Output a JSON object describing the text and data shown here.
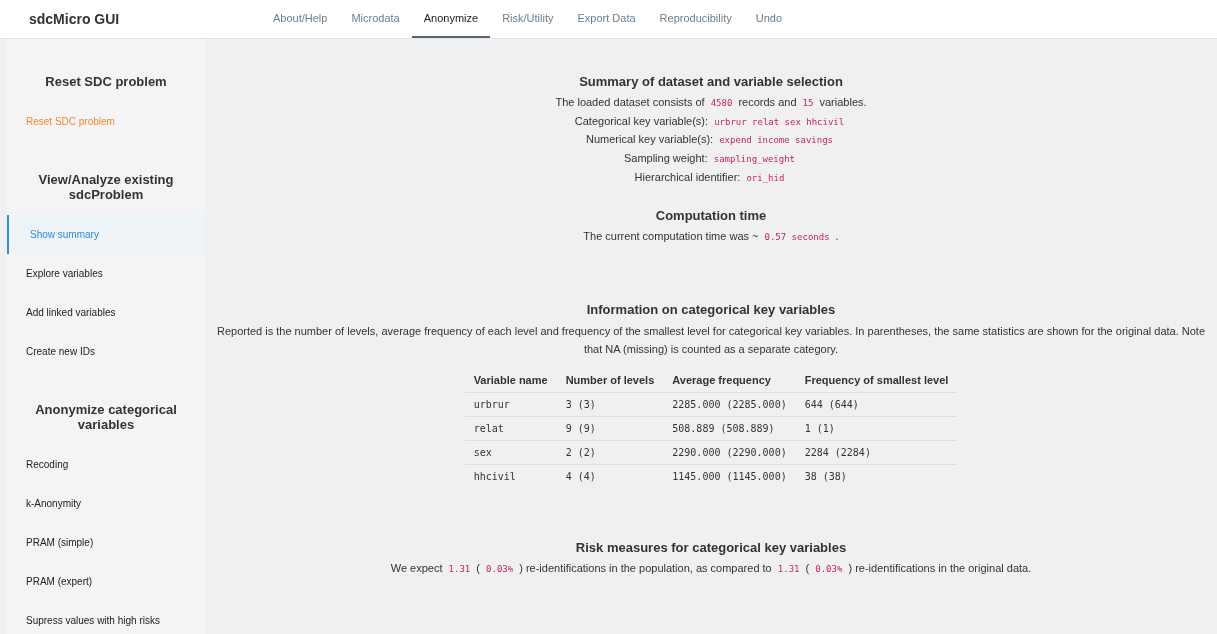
{
  "app_title": "sdcMicro GUI",
  "tabs": [
    {
      "label": "About/Help",
      "selected": false
    },
    {
      "label": "Microdata",
      "selected": false
    },
    {
      "label": "Anonymize",
      "selected": true
    },
    {
      "label": "Risk/Utility",
      "selected": false
    },
    {
      "label": "Export Data",
      "selected": false
    },
    {
      "label": "Reproducibility",
      "selected": false
    },
    {
      "label": "Undo",
      "selected": false
    }
  ],
  "sidebar": {
    "sections": [
      {
        "heading": "Reset SDC problem",
        "items": [
          {
            "label": "Reset SDC problem",
            "kind": "action",
            "selected": false
          }
        ]
      },
      {
        "heading": "View/Analyze existing sdcProblem",
        "items": [
          {
            "label": "Show summary",
            "kind": "nav",
            "selected": true
          },
          {
            "label": "Explore variables",
            "kind": "nav",
            "selected": false
          },
          {
            "label": "Add linked variables",
            "kind": "nav",
            "selected": false
          },
          {
            "label": "Create new IDs",
            "kind": "nav",
            "selected": false
          }
        ]
      },
      {
        "heading": "Anonymize categorical variables",
        "items": [
          {
            "label": "Recoding",
            "kind": "nav",
            "selected": false
          },
          {
            "label": "k-Anonymity",
            "kind": "nav",
            "selected": false
          },
          {
            "label": "PRAM (simple)",
            "kind": "nav",
            "selected": false
          },
          {
            "label": "PRAM (expert)",
            "kind": "nav",
            "selected": false
          },
          {
            "label": "Supress values with high risks",
            "kind": "nav",
            "selected": false
          }
        ]
      }
    ]
  },
  "summary": {
    "title": "Summary of dataset and variable selection",
    "lines": [
      [
        {
          "kind": "text",
          "text": "The loaded dataset consists of "
        },
        {
          "kind": "code",
          "text": "4580"
        },
        {
          "kind": "text",
          "text": " records and "
        },
        {
          "kind": "code",
          "text": "15"
        },
        {
          "kind": "text",
          "text": " variables."
        }
      ],
      [
        {
          "kind": "text",
          "text": "Categorical key variable(s): "
        },
        {
          "kind": "code",
          "text": "urbrur relat sex hhcivil"
        }
      ],
      [
        {
          "kind": "text",
          "text": "Numerical key variable(s): "
        },
        {
          "kind": "code",
          "text": "expend income savings"
        }
      ],
      [
        {
          "kind": "text",
          "text": "Sampling weight: "
        },
        {
          "kind": "code",
          "text": "sampling_weight"
        }
      ],
      [
        {
          "kind": "text",
          "text": "Hierarchical identifier: "
        },
        {
          "kind": "code",
          "text": "ori_hid"
        }
      ]
    ]
  },
  "computation": {
    "title": "Computation time",
    "lines": [
      [
        {
          "kind": "text",
          "text": "The current computation time was ~ "
        },
        {
          "kind": "code",
          "text": "0.57 seconds"
        },
        {
          "kind": "text",
          "text": " ."
        }
      ]
    ]
  },
  "categorical_info": {
    "title": "Information on categorical key variables",
    "description": "Reported is the number of levels, average frequency of each level and frequency of the smallest level for categorical key variables. In parentheses, the same statistics are shown for the original data. Note that NA (missing) is counted as a separate category.",
    "table": {
      "columns": [
        "Variable name",
        "Number of levels",
        "Average frequency",
        "Frequency of smallest level"
      ],
      "rows": [
        [
          "urbrur",
          "3 (3)",
          "2285.000 (2285.000)",
          "644 (644)"
        ],
        [
          "relat",
          "9 (9)",
          "508.889 (508.889)",
          "1 (1)"
        ],
        [
          "sex",
          "2 (2)",
          "2290.000 (2290.000)",
          "2284 (2284)"
        ],
        [
          "hhcivil",
          "4 (4)",
          "1145.000 (1145.000)",
          "38 (38)"
        ]
      ]
    }
  },
  "risk": {
    "title": "Risk measures for categorical key variables",
    "lines": [
      [
        {
          "kind": "text",
          "text": "We expect "
        },
        {
          "kind": "code",
          "text": "1.31"
        },
        {
          "kind": "text",
          "text": " ( "
        },
        {
          "kind": "code",
          "text": "0.03%"
        },
        {
          "kind": "text",
          "text": " ) re-identifications in the population, as compared to "
        },
        {
          "kind": "code",
          "text": "1.31"
        },
        {
          "kind": "text",
          "text": " ( "
        },
        {
          "kind": "code",
          "text": "0.03%"
        },
        {
          "kind": "text",
          "text": " ) re-identifications in the original data."
        }
      ]
    ]
  }
}
